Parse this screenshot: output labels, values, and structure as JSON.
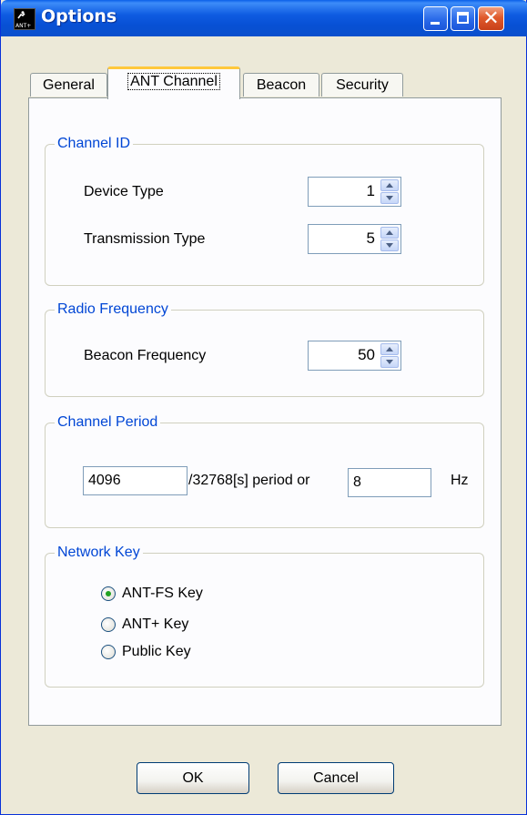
{
  "window": {
    "title": "Options",
    "icon_text": "ANT+"
  },
  "tabs": [
    {
      "label": "General",
      "active": false
    },
    {
      "label": "ANT Channel",
      "active": true
    },
    {
      "label": "Beacon",
      "active": false
    },
    {
      "label": "Security",
      "active": false
    }
  ],
  "channel_id": {
    "title": "Channel ID",
    "device_type_label": "Device Type",
    "device_type_value": "1",
    "transmission_type_label": "Transmission Type",
    "transmission_type_value": "5"
  },
  "radio_frequency": {
    "title": "Radio Frequency",
    "beacon_frequency_label": "Beacon Frequency",
    "beacon_frequency_value": "50"
  },
  "channel_period": {
    "title": "Channel Period",
    "period_value": "4096",
    "period_suffix": "/32768[s] period or",
    "hz_value": "8",
    "hz_label": "Hz"
  },
  "network_key": {
    "title": "Network Key",
    "options": [
      {
        "label": "ANT-FS Key",
        "selected": true
      },
      {
        "label": "ANT+ Key",
        "selected": false
      },
      {
        "label": "Public Key",
        "selected": false
      }
    ]
  },
  "buttons": {
    "ok": "OK",
    "cancel": "Cancel"
  },
  "colors": {
    "title_bar": "#0750D4",
    "group_title": "#0046D5",
    "active_tab_accent": "#FFC83C",
    "radio_selected": "#21A121",
    "close_button": "#E05A2C"
  }
}
